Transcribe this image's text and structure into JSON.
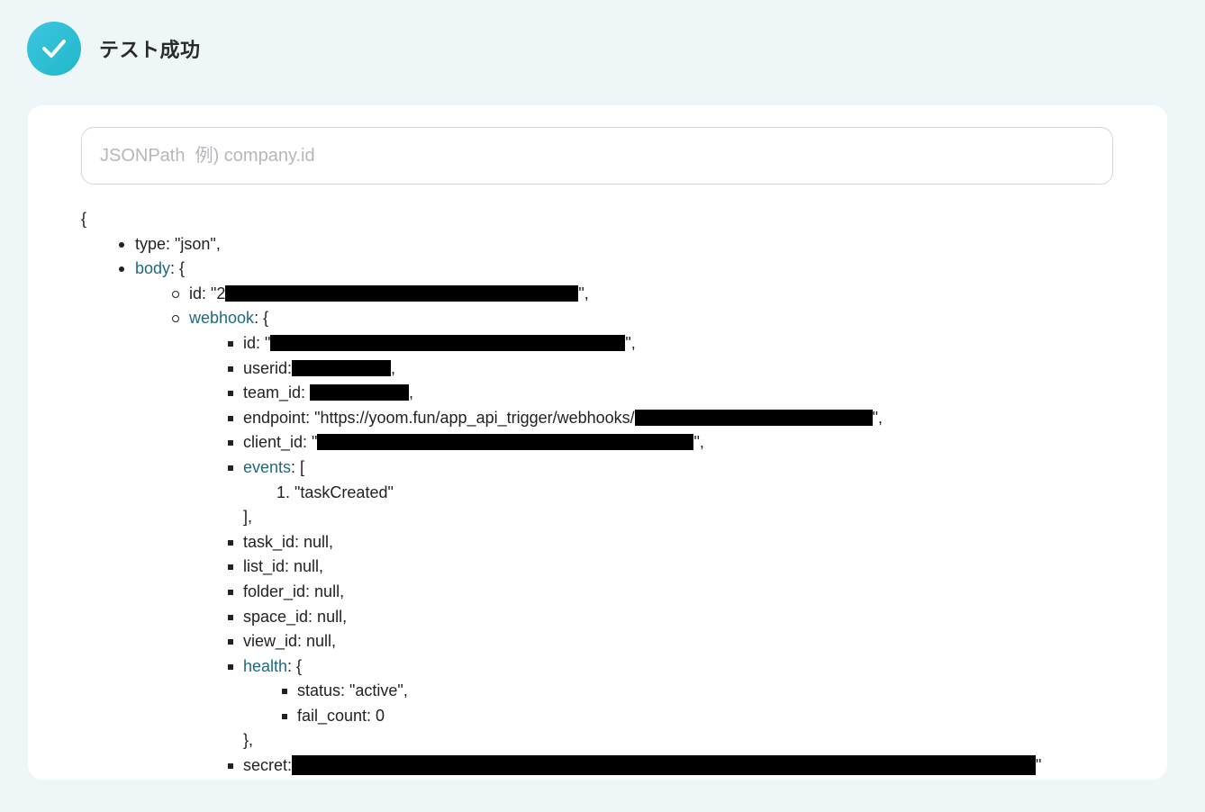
{
  "header": {
    "status_title": "テスト成功",
    "icon": "check-circle-icon",
    "accent_color": "#22bfd3"
  },
  "search": {
    "placeholder": "JSONPath  例) company.id"
  },
  "tree": {
    "open_brace": "{",
    "type_line": "type: \"json\",",
    "body_key": "body",
    "body_open": ": {",
    "body_id_prefix": "id: \"2",
    "body_id_suffix": "\",",
    "webhook_key": "webhook",
    "webhook_open": ": {",
    "wh_id_prefix": "id: \"",
    "wh_id_suffix": "\",",
    "userid_prefix": "userid:",
    "userid_suffix": ",",
    "team_id_prefix": "team_id: ",
    "team_id_suffix": ",",
    "endpoint_prefix": "endpoint: \"https://yoom.fun/app_api_trigger/webhooks/",
    "endpoint_suffix": "\",",
    "client_id_prefix": "client_id: \"",
    "client_id_suffix": "\",",
    "events_key": "events",
    "events_open": ": [",
    "events_item": "\"taskCreated\"",
    "events_item_index": "1.",
    "events_close": "],",
    "task_id": "task_id: null,",
    "list_id": "list_id: null,",
    "folder_id": "folder_id: null,",
    "space_id": "space_id: null,",
    "view_id": "view_id: null,",
    "health_key": "health",
    "health_open": ": {",
    "health_status": "status: \"active\",",
    "health_fail_count": "fail_count: 0",
    "health_close": "},",
    "secret_prefix": "secret:",
    "secret_suffix": "\""
  }
}
